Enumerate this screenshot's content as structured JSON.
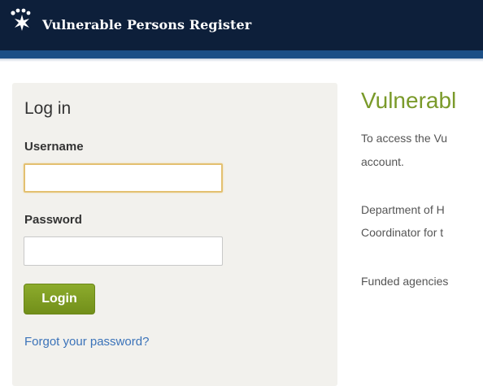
{
  "header": {
    "title": "Vulnerable Persons Register",
    "logo_icon": "paw-sparkle-icon"
  },
  "login": {
    "heading": "Log in",
    "username_label": "Username",
    "username_value": "",
    "password_label": "Password",
    "password_value": "",
    "login_button": "Login",
    "forgot_link": "Forgot your password?"
  },
  "content": {
    "heading": "Vulnerabl",
    "para1_line1": "To access the Vu",
    "para1_line2": "account.",
    "para2_line1": "Department of H",
    "para2_line2": "Coordinator for t",
    "para3_line1": "Funded agencies"
  },
  "colors": {
    "header_bg": "#0d1f3a",
    "accent_bar": "#1c4f86",
    "login_button": "#7f9d22",
    "heading_green": "#7a9a2a",
    "link_blue": "#3b73b9"
  }
}
